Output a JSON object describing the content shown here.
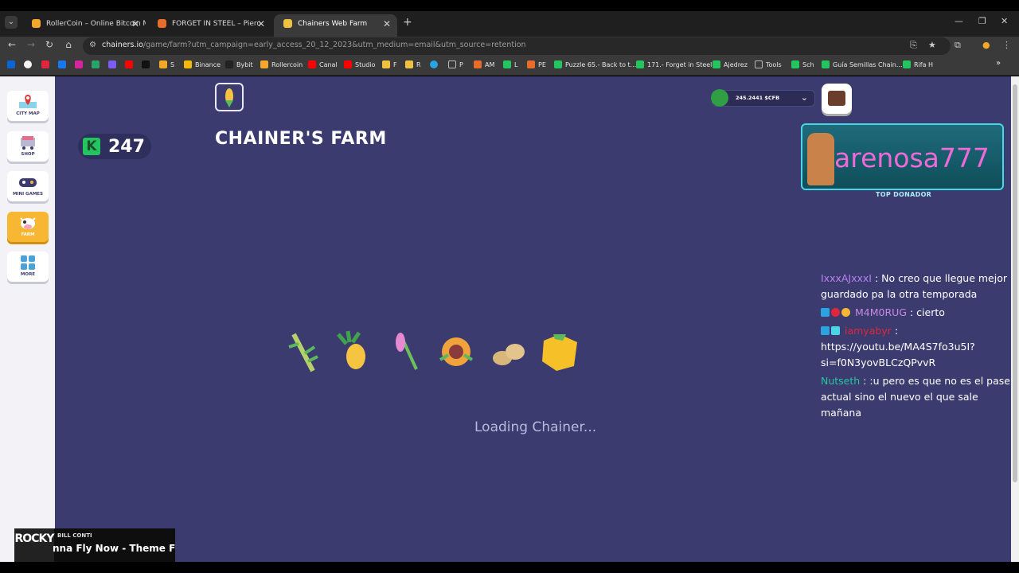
{
  "browser": {
    "tabs": [
      {
        "title": "RollerCoin – Online Bitcoin Mi",
        "active": false,
        "color": "#f4a72b"
      },
      {
        "title": "FORGET IN STEEL – Piero",
        "active": false,
        "color": "#e86d2b"
      },
      {
        "title": "Chainers Web Farm",
        "active": true,
        "color": "#f0c040"
      }
    ],
    "url_host": "chainers.io",
    "url_path": "/game/farm?utm_campaign=early_access_20_12_2023&utm_medium=email&utm_source=retention",
    "bookmarks": [
      {
        "label": "S",
        "color": "#f4a72b"
      },
      {
        "label": "Binance",
        "color": "#f0b90b"
      },
      {
        "label": "Bybit",
        "color": "#222222"
      },
      {
        "label": "Rollercoin",
        "color": "#f4a72b"
      },
      {
        "label": "Canal",
        "color": "#ff0000"
      },
      {
        "label": "Studio",
        "color": "#ff0000"
      },
      {
        "label": "F",
        "color": "#f0c040"
      },
      {
        "label": "R",
        "color": "#f0c040"
      },
      {
        "label": "P",
        "color": "#888888"
      },
      {
        "label": "AM",
        "color": "#e86d2b"
      },
      {
        "label": "L",
        "color": "#22c55e"
      },
      {
        "label": "PE",
        "color": "#e86d2b"
      },
      {
        "label": "Puzzle 65.- Back to t...",
        "color": "#22c55e"
      },
      {
        "label": "171.- Forget in Steel",
        "color": "#22c55e"
      },
      {
        "label": "Ajedrez",
        "color": "#22c55e"
      },
      {
        "label": "Tools",
        "color": "#888888"
      },
      {
        "label": "Sch",
        "color": "#22c55e"
      },
      {
        "label": "Guía Semillas Chain...",
        "color": "#22c55e"
      },
      {
        "label": "Rifa H",
        "color": "#22c55e"
      }
    ]
  },
  "sidebar": {
    "items": [
      {
        "label": "CITY MAP",
        "active": false
      },
      {
        "label": "SHOP",
        "active": false
      },
      {
        "label": "MINI GAMES",
        "active": false
      },
      {
        "label": "FARM",
        "active": true
      },
      {
        "label": "MORE",
        "active": false
      }
    ]
  },
  "kick": {
    "letter": "K",
    "count": "247"
  },
  "farm": {
    "title": "CHAINER'S FARM",
    "loading": "Loading Chainer..."
  },
  "wallet": {
    "amount": "245.2441 $CFB"
  },
  "donor": {
    "name": "arenosa777",
    "label": "TOP DONADOR"
  },
  "chat": [
    {
      "user": "IxxxAJxxxI",
      "text": ": No creo que llegue mejor guardado pa la otra temporada"
    },
    {
      "user": "M4M0RUG",
      "text": ": cierto"
    },
    {
      "user": "iamyabyr",
      "text": ": https://youtu.be/MA4S7fo3u5I?si=f0N3yovBLCzQPvvR"
    },
    {
      "user": "Nutseth",
      "text": ": :u pero es que no es el pase actual sino el nuevo el que sale mañana"
    }
  ],
  "music": {
    "cover": "ROCKY",
    "artist": "BILL CONTI",
    "song": "nna Fly Now - Theme Fro"
  },
  "colors": {
    "page_bg": "#3b3b70",
    "accent": "#f7b733",
    "kick_green": "#22c55e"
  }
}
